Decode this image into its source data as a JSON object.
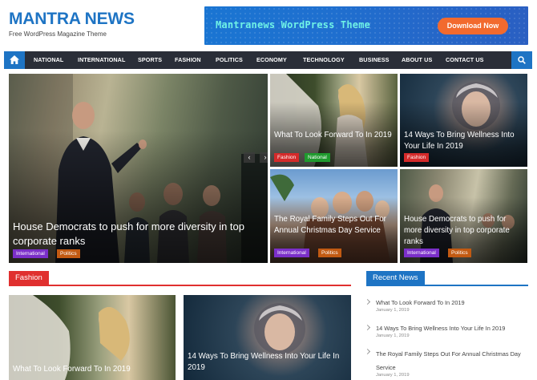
{
  "site": {
    "title": "MANTRA NEWS",
    "tagline": "Free WordPress Magazine Theme"
  },
  "banner": {
    "text": "Mantranews WordPress Theme",
    "button": "Download Now"
  },
  "nav": {
    "items": [
      "NATIONAL",
      "INTERNATIONAL",
      "SPORTS",
      "FASHION",
      "POLITICS",
      "ECONOMY",
      "TECHNOLOGY",
      "BUSINESS",
      "ABOUT US",
      "CONTACT US"
    ]
  },
  "featured": {
    "main": {
      "title": "House Democrats to push for more diversity in top corporate ranks",
      "tags": [
        "International",
        "Politics"
      ]
    },
    "side": [
      {
        "title": "What To Look Forward To In 2019",
        "tags": [
          "Fashion",
          "National"
        ]
      },
      {
        "title": "14 Ways To Bring Wellness Into Your Life In 2019",
        "tags": [
          "Fashion"
        ]
      },
      {
        "title": "The Royal Family Steps Out For Annual Christmas Day Service",
        "tags": [
          "International",
          "Politics"
        ]
      },
      {
        "title": "House Democrats to push for more diversity in top corporate ranks",
        "tags": [
          "International",
          "Politics"
        ]
      }
    ]
  },
  "fashion": {
    "heading": "Fashion",
    "posts": [
      {
        "title": "What To Look Forward To In 2019"
      },
      {
        "title": "14 Ways To Bring Wellness Into Your Life In 2019"
      }
    ]
  },
  "recent": {
    "heading": "Recent News",
    "items": [
      {
        "title": "What To Look Forward To In 2019",
        "date": "January 1, 2019"
      },
      {
        "title": "14 Ways To Bring Wellness Into Your Life In 2019",
        "date": "January 1, 2019"
      },
      {
        "title": "The Royal Family Steps Out For Annual Christmas Day Service",
        "date": "January 1, 2019"
      }
    ]
  },
  "colors": {
    "brand": "#1e74c4",
    "nav_bg": "#2a2e38",
    "fashion_tag": "#d42a2a",
    "national_tag": "#1f9a2e",
    "international_tag": "#7b2fc9",
    "politics_tag": "#c25a12"
  },
  "icons": {
    "home": "home-icon",
    "search": "search-icon",
    "prev": "chevron-left-icon",
    "next": "chevron-right-icon"
  }
}
